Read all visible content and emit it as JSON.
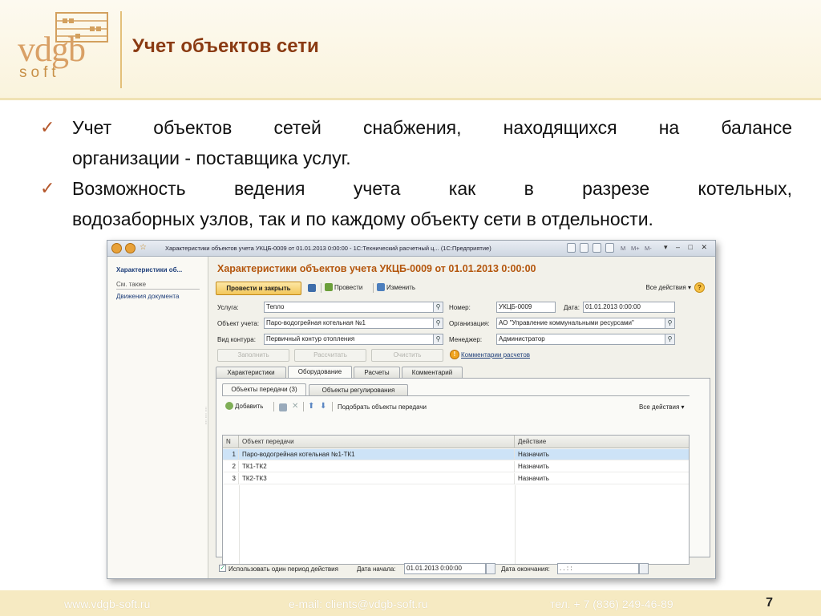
{
  "slide": {
    "title": "Учет объектов сети",
    "logo": {
      "brand": "vdgb",
      "sub": "soft"
    },
    "bullets": [
      {
        "line1": "Учет объектов сетей снабжения, находящихся на балансе",
        "line2": "организации - поставщика услуг."
      },
      {
        "line1": "Возможность ведения учета как в разрезе котельных,",
        "line2": "водозаборных узлов, так и по каждому объекту сети в отдельности."
      }
    ],
    "footer": {
      "site": "www.vdgb-soft.ru",
      "email": "e-mail: clients@vdgb-soft.ru",
      "phone": "тел. + 7 (836) 249-46-89",
      "page": "7"
    }
  },
  "window": {
    "title": "Характеристики объектов учета УКЦБ-0009 от 01.01.2013 0:00:00 - 1С:Технический расчетный ц... (1С:Предприятие)",
    "mem_buttons": [
      "M",
      "M+",
      "M-"
    ],
    "left_panel": {
      "title": "Характеристики об...",
      "see_also": "См. также",
      "movements": "Движения документа"
    },
    "form": {
      "heading": "Характеристики объектов учета УКЦБ-0009 от 01.01.2013 0:00:00",
      "toolbar": {
        "post_close": "Провести и закрыть",
        "post": "Провести",
        "edit": "Изменить",
        "all_actions": "Все действия ▾",
        "help": "?"
      },
      "fields": {
        "service_label": "Услуга:",
        "service": "Тепло",
        "number_label": "Номер:",
        "number": "УКЦБ-0009",
        "date_label": "Дата:",
        "date": "01.01.2013  0:00:00",
        "object_label": "Объект учета:",
        "object": "Паро-водогрейная котельная №1",
        "org_label": "Организация:",
        "org": "АО \"Управление коммунальными ресурсами\"",
        "contour_label": "Вид контура:",
        "contour": "Первичный контур отопления",
        "manager_label": "Менеджер:",
        "manager": "Администратор"
      },
      "actions": {
        "fill": "Заполнить",
        "calculate": "Рассчитать",
        "clear": "Очистить",
        "calc_comments": "Комментарии расчетов"
      },
      "tabs": [
        "Характеристики",
        "Оборудование",
        "Расчеты",
        "Комментарий"
      ],
      "subtabs": [
        "Объекты передачи (3)",
        "Объекты регулирования"
      ],
      "subtoolbar": {
        "add": "Добавить",
        "pick": "Подобрать объекты передачи",
        "all_actions": "Все действия ▾"
      },
      "table": {
        "headers": [
          "N",
          "Объект передачи",
          "Действие"
        ],
        "rows": [
          {
            "n": "1",
            "object": "Паро-водогрейная котельная №1-ТК1",
            "action": "Назначить"
          },
          {
            "n": "2",
            "object": "ТК1-ТК2",
            "action": "Назначить"
          },
          {
            "n": "3",
            "object": "ТК2-ТК3",
            "action": "Назначить"
          }
        ]
      },
      "bottom": {
        "use_one_period": "Использовать один период действия",
        "start_label": "Дата начала:",
        "start": "01.01.2013  0:00:00",
        "end_label": "Дата окончания:",
        "end": " .  .     :  :"
      }
    }
  }
}
